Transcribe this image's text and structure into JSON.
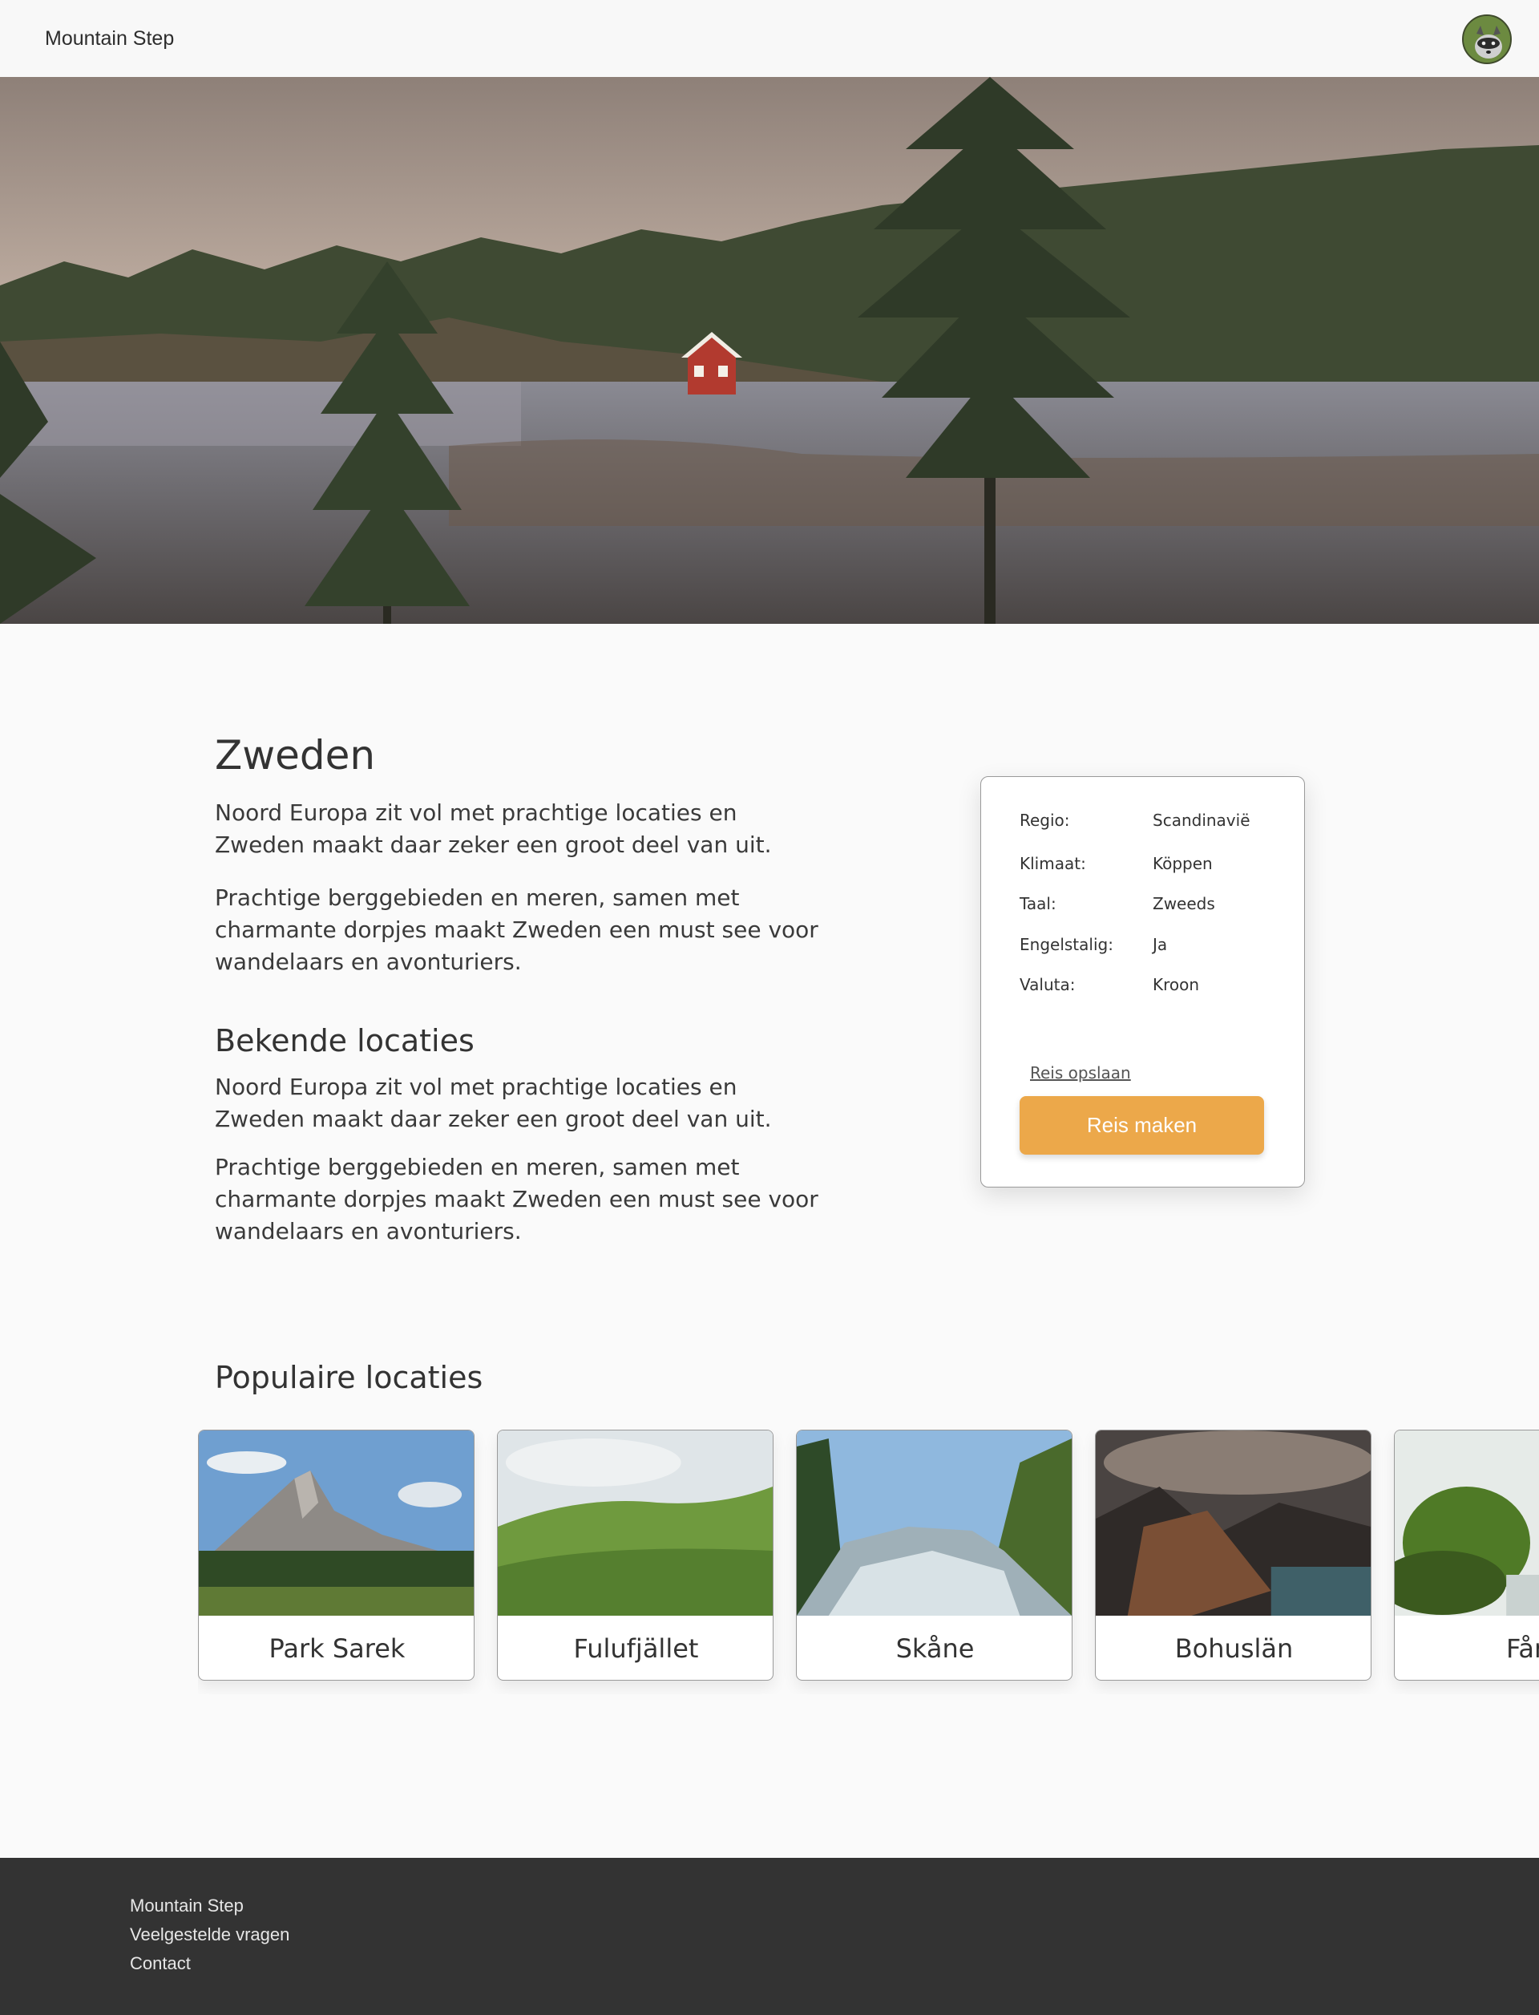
{
  "header": {
    "brand": "Mountain Step",
    "avatar_icon": "raccoon-avatar-icon"
  },
  "hero": {
    "image": "lake-with-red-cabin-and-pine-trees"
  },
  "main": {
    "title": "Zweden",
    "intro": [
      "Noord Europa zit vol met prachtige locaties en Zweden maakt daar zeker een groot deel van uit.",
      "Prachtige berggebieden en meren, samen met charmante dorpjes maakt Zweden een must see voor wandelaars en avonturiers."
    ],
    "known_title": "Bekende locaties",
    "known": [
      "Noord Europa zit vol met prachtige locaties en Zweden maakt daar zeker een groot deel van uit.",
      "Prachtige berggebieden en meren, samen met charmante dorpjes maakt Zweden een must see voor wandelaars en avonturiers."
    ]
  },
  "info": {
    "rows": [
      {
        "label": "Regio:",
        "value": "Scandinavië"
      },
      {
        "label": "Klimaat:",
        "value": "Köppen"
      },
      {
        "label": "Taal:",
        "value": "Zweeds"
      },
      {
        "label": "Engelstalig:",
        "value": "Ja"
      },
      {
        "label": "Valuta:",
        "value": "Kroon"
      }
    ],
    "save_label": "Reis opslaan",
    "make_label": "Reis maken",
    "accent": "#eca84a"
  },
  "popular": {
    "title": "Populaire locaties",
    "cards": [
      {
        "label": "Park Sarek",
        "image": "rocky-mountain-peak"
      },
      {
        "label": "Fulufjället",
        "image": "green-hills"
      },
      {
        "label": "Skåne",
        "image": "forest-river"
      },
      {
        "label": "Bohuslän",
        "image": "dark-mountains-lake"
      },
      {
        "label": "Fårö",
        "image": "mossy-rock-stream"
      }
    ]
  },
  "footer": {
    "links": [
      "Mountain Step",
      "Veelgestelde vragen",
      "Contact"
    ],
    "background": "#333333"
  }
}
